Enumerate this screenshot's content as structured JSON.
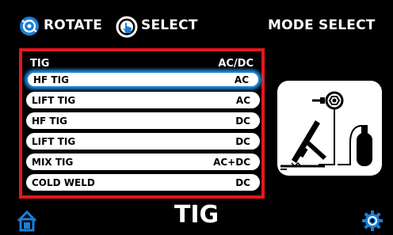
{
  "header": {
    "rotate_label": "ROTATE",
    "select_label": "SELECT",
    "mode_label": "MODE SELECT"
  },
  "menu": {
    "header_left": "TIG",
    "header_right": "AC/DC",
    "items": [
      {
        "label": "HF TIG",
        "value": "AC",
        "selected": true
      },
      {
        "label": "LIFT TIG",
        "value": "AC"
      },
      {
        "label": "HF TIG",
        "value": "DC"
      },
      {
        "label": "LIFT TIG",
        "value": "DC"
      },
      {
        "label": "MIX TIG",
        "value": "AC+DC"
      },
      {
        "label": "COLD WELD",
        "value": "DC"
      }
    ]
  },
  "footer": {
    "title": "TIG",
    "home_icon": "home-icon",
    "settings_icon": "gear-icon"
  },
  "colors": {
    "accent": "#1a7fd6",
    "frame": "#e8161a",
    "background": "#000000"
  }
}
